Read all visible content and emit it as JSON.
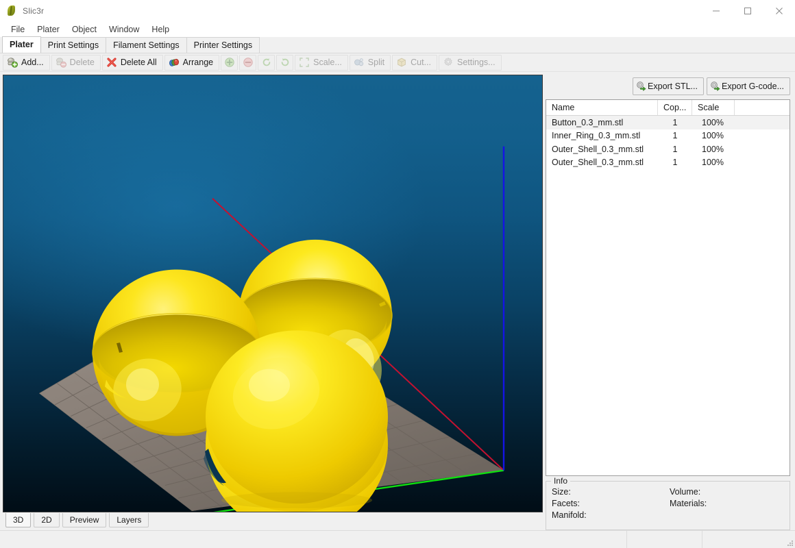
{
  "window": {
    "title": "Slic3r",
    "app_icon": "slic3r-leaf-icon",
    "controls": {
      "minimize": "minimize-icon",
      "maximize": "maximize-icon",
      "close": "close-icon"
    }
  },
  "menubar": {
    "items": [
      {
        "label": "File"
      },
      {
        "label": "Plater"
      },
      {
        "label": "Object"
      },
      {
        "label": "Window"
      },
      {
        "label": "Help"
      }
    ]
  },
  "tabs": [
    {
      "label": "Plater",
      "active": true
    },
    {
      "label": "Print Settings",
      "active": false
    },
    {
      "label": "Filament Settings",
      "active": false
    },
    {
      "label": "Printer Settings",
      "active": false
    }
  ],
  "toolbar": {
    "buttons": [
      {
        "label": "Add...",
        "icon": "add-object-icon",
        "enabled": true
      },
      {
        "label": "Delete",
        "icon": "delete-object-icon",
        "enabled": false
      },
      {
        "label": "Delete All",
        "icon": "delete-all-icon",
        "enabled": true
      },
      {
        "label": "Arrange",
        "icon": "arrange-icon",
        "enabled": true
      }
    ],
    "icon_buttons": [
      {
        "name": "increase-copies-button",
        "icon": "plus-circle-icon",
        "enabled": false
      },
      {
        "name": "decrease-copies-button",
        "icon": "minus-circle-icon",
        "enabled": false
      },
      {
        "name": "rotate-ccw-button",
        "icon": "rotate-ccw-icon",
        "enabled": false
      },
      {
        "name": "rotate-cw-button",
        "icon": "rotate-cw-icon",
        "enabled": false
      }
    ],
    "more_buttons": [
      {
        "label": "Scale...",
        "icon": "scale-icon",
        "enabled": false
      },
      {
        "label": "Split",
        "icon": "split-icon",
        "enabled": false
      },
      {
        "label": "Cut...",
        "icon": "cut-icon",
        "enabled": false
      },
      {
        "label": "Settings...",
        "icon": "settings-icon",
        "enabled": false
      }
    ]
  },
  "export": {
    "stl_label": "Export STL...",
    "stl_icon": "export-stl-icon",
    "gcode_label": "Export G-code...",
    "gcode_icon": "export-gcode-icon"
  },
  "object_list": {
    "columns": [
      "Name",
      "Cop...",
      "Scale"
    ],
    "rows": [
      {
        "name": "Button_0.3_mm.stl",
        "copies": "1",
        "scale": "100%",
        "selected": true
      },
      {
        "name": "Inner_Ring_0.3_mm.stl",
        "copies": "1",
        "scale": "100%",
        "selected": false
      },
      {
        "name": "Outer_Shell_0.3_mm.stl",
        "copies": "1",
        "scale": "100%",
        "selected": false
      },
      {
        "name": "Outer_Shell_0.3_mm.stl",
        "copies": "1",
        "scale": "100%",
        "selected": false
      }
    ]
  },
  "info": {
    "legend": "Info",
    "size_label": "Size:",
    "size_value": "",
    "volume_label": "Volume:",
    "volume_value": "",
    "facets_label": "Facets:",
    "facets_value": "",
    "materials_label": "Materials:",
    "materials_value": "",
    "manifold_label": "Manifold:",
    "manifold_value": ""
  },
  "view_tabs": [
    {
      "label": "3D",
      "active": true
    },
    {
      "label": "2D",
      "active": false
    },
    {
      "label": "Preview",
      "active": false
    },
    {
      "label": "Layers",
      "active": false
    }
  ],
  "viewport": {
    "background_top": "#15628f",
    "background_bottom": "#010d16",
    "object_color": "#f2d302",
    "bed_color": "#8a8078",
    "axis_x_color": "#c41230",
    "axis_y_color": "#10e010",
    "axis_z_color": "#1414e6"
  },
  "statusbar": {
    "message": ""
  }
}
